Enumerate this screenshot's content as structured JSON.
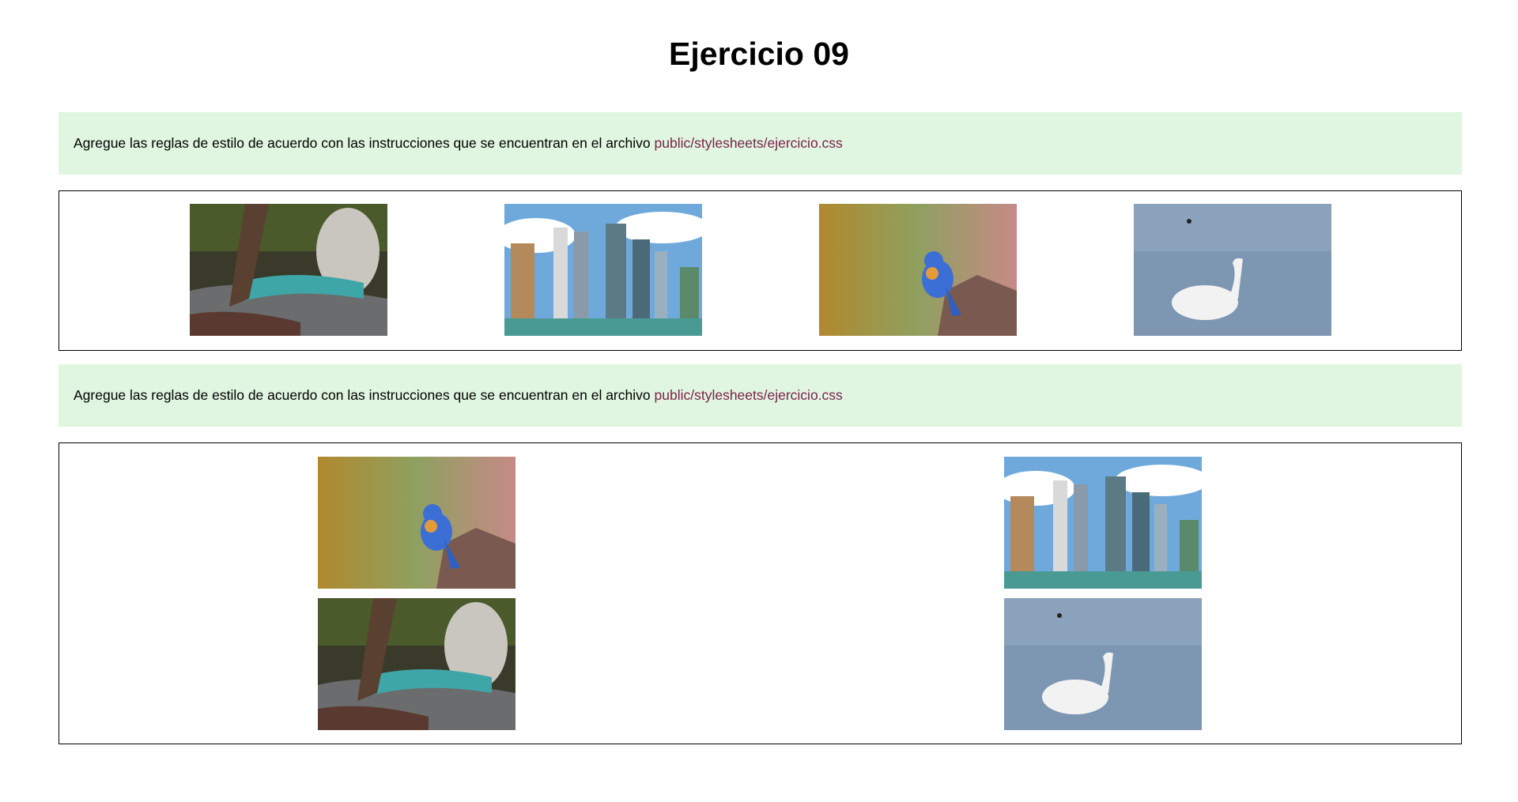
{
  "page": {
    "title": "Ejercicio 09"
  },
  "notes": [
    {
      "text": "Agregue las reglas de estilo de acuerdo con las instrucciones que se encuentran en el archivo ",
      "link": "public/stylesheets/ejercicio.css"
    },
    {
      "text": "Agregue las reglas de estilo de acuerdo con las instrucciones que se encuentran en el archivo ",
      "link": "public/stylesheets/ejercicio.css"
    }
  ],
  "gallery1": [
    "forest-river-photo",
    "city-skyline-photo",
    "blue-bird-photo",
    "swan-photo"
  ],
  "gallery2": [
    "blue-bird-photo",
    "city-skyline-photo",
    "forest-river-photo",
    "swan-photo"
  ],
  "colors": {
    "note_bg": "#e0f6e0",
    "link": "#7a1f4b",
    "border": "#000000"
  }
}
